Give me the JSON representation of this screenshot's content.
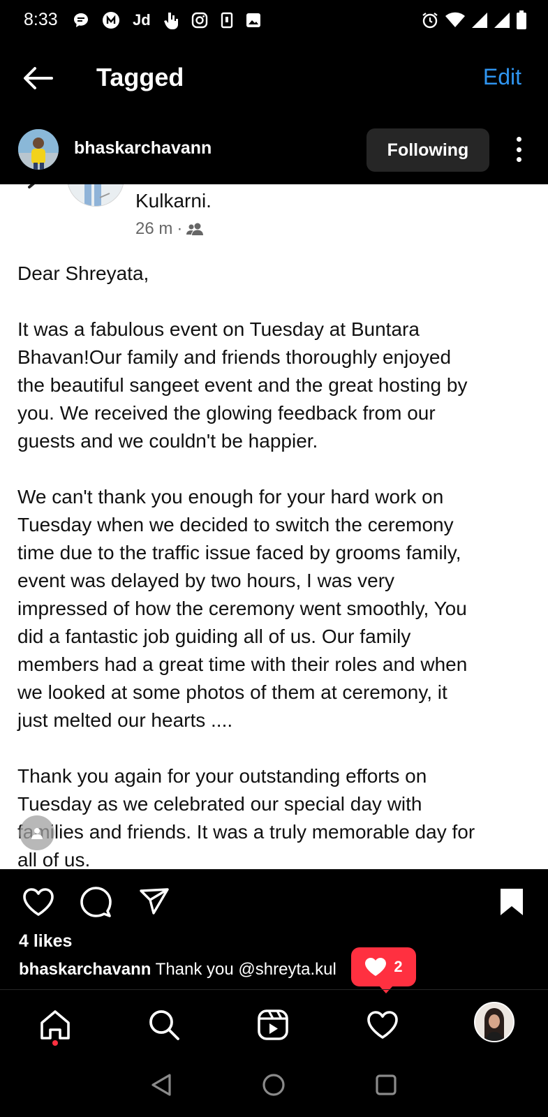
{
  "status_bar": {
    "time": "8:33",
    "left_icons": [
      "chat-bubble-icon",
      "wallet-icon",
      "jd-icon",
      "hand-icon",
      "instagram-icon",
      "sim-icon",
      "image-icon"
    ],
    "jd_label": "Jd",
    "right_icons": [
      "alarm-icon",
      "wifi-icon",
      "signal-icon",
      "signal-icon",
      "battery-icon"
    ]
  },
  "header": {
    "title": "Tagged",
    "edit_label": "Edit",
    "accent_color": "#2f95f0"
  },
  "account": {
    "username": "bhaskarchavann",
    "following_label": "Following"
  },
  "post": {
    "sender_name": "Kulkarni.",
    "time": "26 m",
    "separator": "·",
    "audience_icon": "friends-icon",
    "paragraphs": [
      "Dear Shreyata,",
      "It was a fabulous event on Tuesday at Buntara\nBhavan!Our family and friends thoroughly enjoyed\nthe beautiful sangeet event and the great hosting by\nyou. We received the glowing feedback from our\nguests and we couldn't be happier.",
      "We can't thank you enough for your hard work on\nTuesday when we decided to switch the ceremony\ntime due to the traffic issue faced by grooms family,\nevent was delayed by two hours, I was very\nimpressed of how the ceremony went smoothly, You\ndid a fantastic job guiding all of us.  Our family\nmembers had a great time with their roles and when\nwe looked at some photos of them at ceremony, it\njust melted our hearts ....",
      "Thank you again for your outstanding efforts on\nTuesday as we celebrated our special day with\nfamilies and friends.  It was a truly memorable day for\nall of us."
    ]
  },
  "actions": {
    "likes": "4 likes",
    "caption_user": "bhaskarchavann",
    "caption_text": "Thank you @shreyta.kul"
  },
  "notification": {
    "count": "2",
    "color": "#ff3040"
  },
  "bottom_nav": {
    "items": [
      "home-icon",
      "search-icon",
      "reels-icon",
      "heart-icon",
      "profile-avatar"
    ]
  }
}
